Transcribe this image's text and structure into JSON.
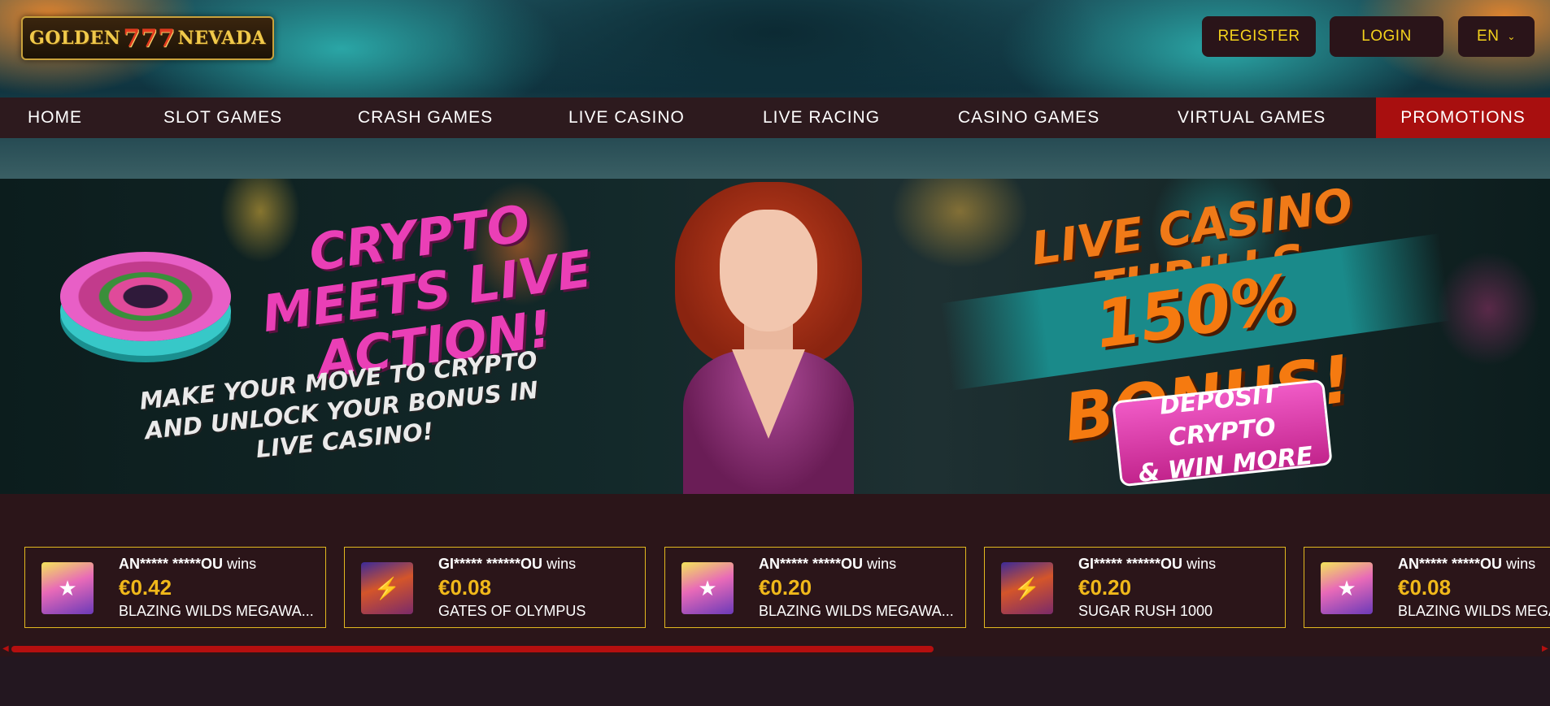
{
  "header": {
    "logo": {
      "left": "GOLDEN",
      "sevens": "777",
      "right": "NEVADA"
    },
    "register_label": "REGISTER",
    "login_label": "LOGIN",
    "language": "EN"
  },
  "nav": {
    "items": [
      "HOME",
      "SLOT GAMES",
      "CRASH GAMES",
      "LIVE CASINO",
      "LIVE RACING",
      "CASINO GAMES",
      "VIRTUAL GAMES"
    ],
    "promotions": "PROMOTIONS"
  },
  "banner": {
    "headline_left": "CRYPTO MEETS LIVE ACTION!",
    "subline_left": "MAKE YOUR MOVE TO CRYPTO AND UNLOCK YOUR BONUS IN LIVE CASINO!",
    "headline_right": "LIVE CASINO THRILLS",
    "bonus": "150% BONUS!",
    "cta_line1": "DEPOSIT CRYPTO",
    "cta_line2": "& WIN MORE"
  },
  "winners": [
    {
      "user": "AN***** *****OU",
      "suffix": "wins",
      "amount": "€0.42",
      "game": "BLAZING WILDS MEGAWA...",
      "thumb": "sugar-rush-thumb"
    },
    {
      "user": "GI***** ******OU",
      "suffix": "wins",
      "amount": "€0.08",
      "game": "GATES OF OLYMPUS",
      "thumb": "gates-thumb"
    },
    {
      "user": "AN***** *****OU",
      "suffix": "wins",
      "amount": "€0.20",
      "game": "BLAZING WILDS MEGAWA...",
      "thumb": "sugar-rush-thumb"
    },
    {
      "user": "GI***** ******OU",
      "suffix": "wins",
      "amount": "€0.20",
      "game": "SUGAR RUSH 1000",
      "thumb": "gates-thumb"
    },
    {
      "user": "AN***** *****OU",
      "suffix": "wins",
      "amount": "€0.08",
      "game": "BLAZING WILDS MEGA",
      "thumb": "sugar-rush-thumb"
    }
  ],
  "scroll_position": 0.6
}
